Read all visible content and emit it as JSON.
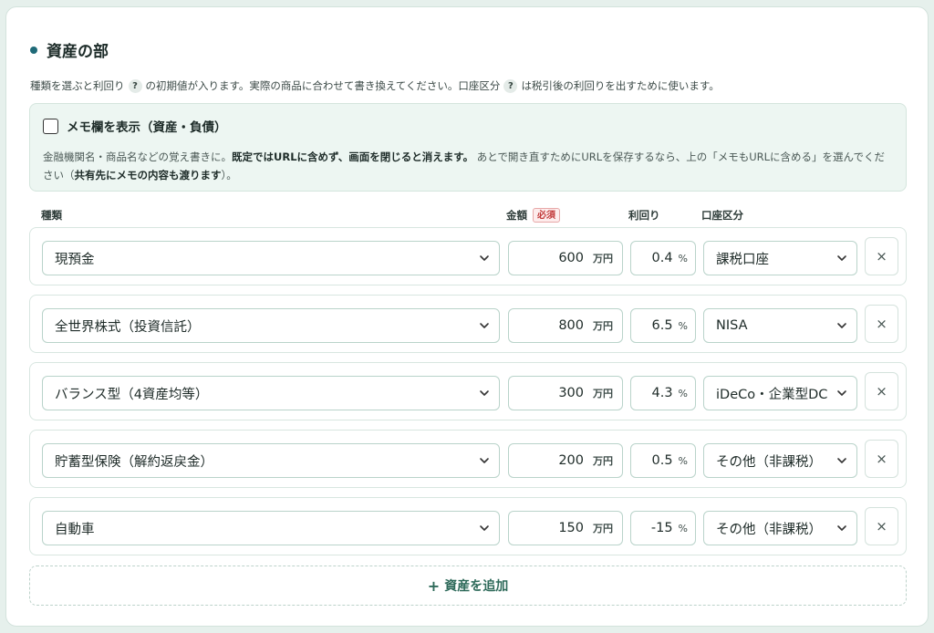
{
  "section": {
    "title": "資産の部",
    "desc_part1": "種類を選ぶと利回り",
    "desc_part2": "の初期値が入ります。実際の商品に合わせて書き換えてください。口座区分",
    "desc_part3": "は税引後の利回りを出すために使います。",
    "help_glyph": "?"
  },
  "memo": {
    "label": "メモ欄を表示（資産・負債）",
    "text_part1": "金融機関名・商品名などの覚え書きに。",
    "text_bold1": "既定ではURLに含めず、画面を閉じると消えます。",
    "text_part2": " あとで開き直すためにURLを保存するなら、上の「メモもURLに含める」を選んでください（",
    "text_bold2": "共有先にメモの内容も渡ります",
    "text_part3": "）。"
  },
  "columns": {
    "type": "種類",
    "amount": "金額",
    "required": "必須",
    "rate": "利回り",
    "account": "口座区分"
  },
  "rows": [
    {
      "type": "現預金",
      "amount": "600",
      "unit": "万円",
      "rate": "0.4",
      "pct": "%",
      "account": "課税口座"
    },
    {
      "type": "全世界株式（投資信託）",
      "amount": "800",
      "unit": "万円",
      "rate": "6.5",
      "pct": "%",
      "account": "NISA"
    },
    {
      "type": "バランス型（4資産均等）",
      "amount": "300",
      "unit": "万円",
      "rate": "4.3",
      "pct": "%",
      "account": "iDeCo・企業型DC"
    },
    {
      "type": "貯蓄型保険（解約返戻金）",
      "amount": "200",
      "unit": "万円",
      "rate": "0.5",
      "pct": "%",
      "account": "その他（非課税）"
    },
    {
      "type": "自動車",
      "amount": "150",
      "unit": "万円",
      "rate": "-15",
      "pct": "%",
      "account": "その他（非課税）"
    }
  ],
  "delete_glyph": "×",
  "add_button": {
    "plus": "+",
    "label": "資産を追加"
  },
  "colors": {
    "accent": "#1f6a78",
    "required_red": "#c23a3a",
    "add_green": "#2e6a5a"
  }
}
